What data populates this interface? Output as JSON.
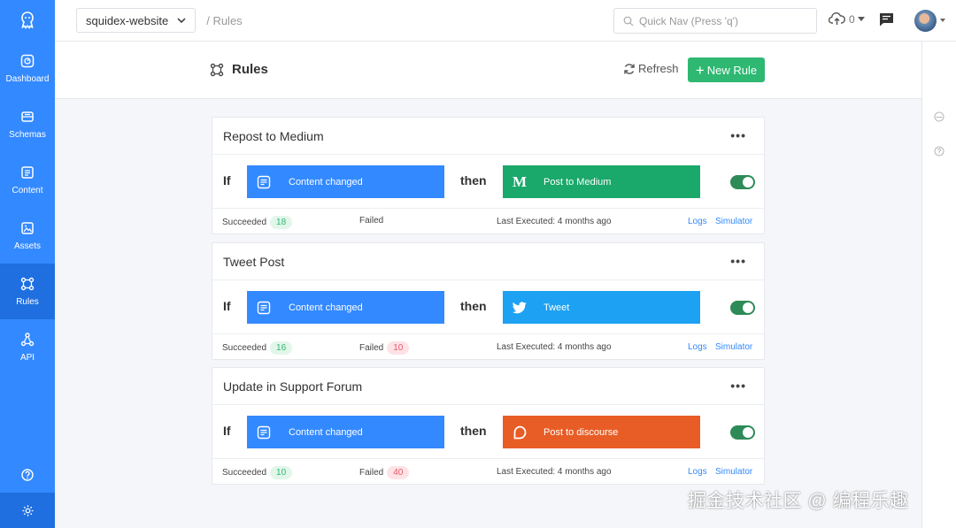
{
  "sidebar": {
    "items": [
      {
        "label": "Dashboard"
      },
      {
        "label": "Schemas"
      },
      {
        "label": "Content"
      },
      {
        "label": "Assets"
      },
      {
        "label": "Rules"
      },
      {
        "label": "API"
      }
    ],
    "active": "Rules"
  },
  "topbar": {
    "app_name": "squidex-website",
    "breadcrumb": "/ Rules",
    "search_placeholder": "Quick Nav (Press 'q')",
    "upload_count": "0"
  },
  "header": {
    "title": "Rules",
    "refresh_label": "Refresh",
    "new_rule_label": "New Rule"
  },
  "rules": [
    {
      "name": "Repost to Medium",
      "if_label": "If",
      "then_label": "then",
      "trigger": "Content changed",
      "action": "Post to Medium",
      "action_color": "#1aa86b",
      "succeeded_label": "Succeeded",
      "succeeded": "18",
      "failed_label": "Failed",
      "failed": "",
      "last_executed": "Last Executed: 4 months ago",
      "logs_label": "Logs",
      "simulator_label": "Simulator",
      "enabled": true
    },
    {
      "name": "Tweet Post",
      "if_label": "If",
      "then_label": "then",
      "trigger": "Content changed",
      "action": "Tweet",
      "action_color": "#1da1f2",
      "succeeded_label": "Succeeded",
      "succeeded": "16",
      "failed_label": "Failed",
      "failed": "10",
      "last_executed": "Last Executed: 4 months ago",
      "logs_label": "Logs",
      "simulator_label": "Simulator",
      "enabled": true
    },
    {
      "name": "Update in Support Forum",
      "if_label": "If",
      "then_label": "then",
      "trigger": "Content changed",
      "action": "Post to discourse",
      "action_color": "#e85d25",
      "succeeded_label": "Succeeded",
      "succeeded": "10",
      "failed_label": "Failed",
      "failed": "40",
      "last_executed": "Last Executed: 4 months ago",
      "logs_label": "Logs",
      "simulator_label": "Simulator",
      "enabled": true
    }
  ],
  "watermark": "掘金技术社区 @ 编程乐趣",
  "colors": {
    "sidebar": "#3389ff",
    "sidebar_active": "#1f6fe0",
    "primary": "#3389ff",
    "success": "#2eb872"
  }
}
